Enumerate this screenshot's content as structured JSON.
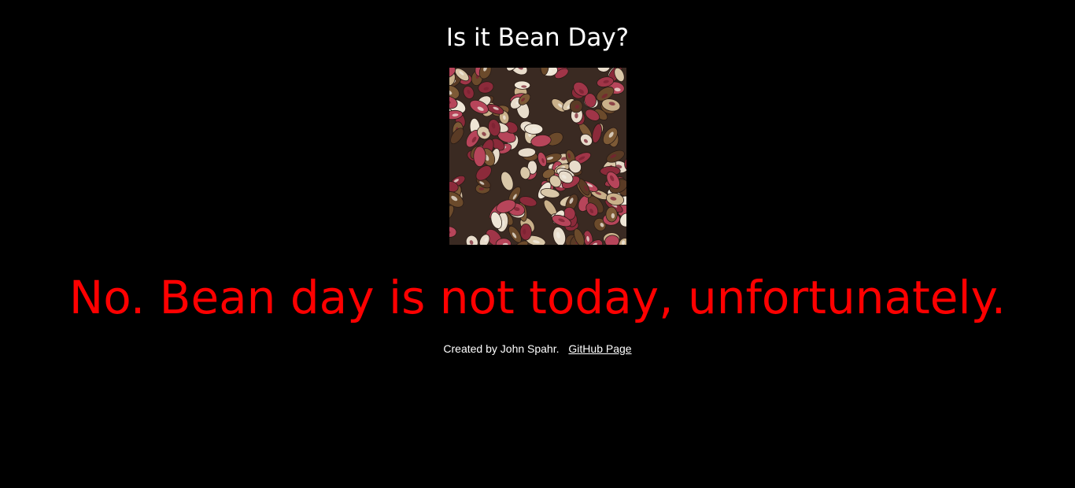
{
  "header": {
    "title": "Is it Bean Day?"
  },
  "image": {
    "subject": "beans-photo"
  },
  "main": {
    "answer": "No. Bean day is not today, unfortunately.",
    "answer_color": "#ff0000"
  },
  "footer": {
    "credit": "Created by John Spahr.",
    "link_label": "GitHub Page"
  },
  "colors": {
    "background": "#000000",
    "text": "#ffffff"
  }
}
